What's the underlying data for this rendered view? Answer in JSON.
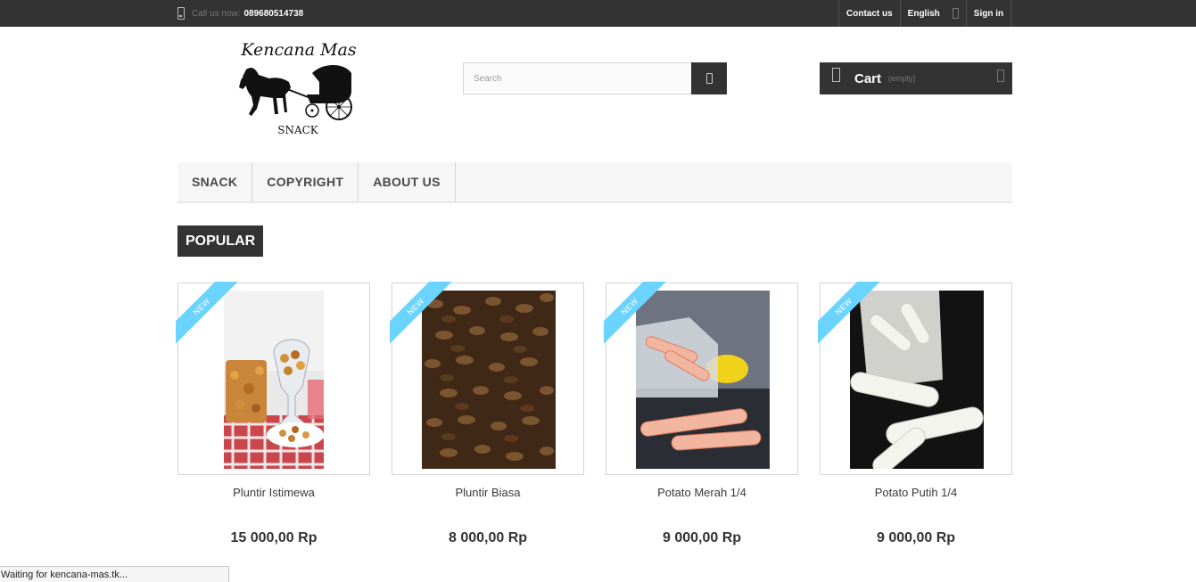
{
  "topbar": {
    "call_prefix": "Call us now:",
    "phone": "089680514738",
    "contact": "Contact us",
    "language": "English",
    "signin": "Sign in"
  },
  "header": {
    "logo_title": "Kencana Mas",
    "logo_sub": "SNACK",
    "search_placeholder": "Search",
    "cart_label": "Cart",
    "cart_status": "(empty)"
  },
  "menu": [
    "SNACK",
    "COPYRIGHT",
    "ABOUT US"
  ],
  "section_tab": "POPULAR",
  "products": [
    {
      "name": "Pluntir Istimewa",
      "price": "15 000,00 Rp",
      "badge": "NEW"
    },
    {
      "name": "Pluntir Biasa",
      "price": "8 000,00 Rp",
      "badge": "NEW"
    },
    {
      "name": "Potato Merah 1/4",
      "price": "9 000,00 Rp",
      "badge": "NEW"
    },
    {
      "name": "Potato Putih 1/4",
      "price": "9 000,00 Rp",
      "badge": "NEW"
    }
  ],
  "status_text": "Waiting for kencana-mas.tk...",
  "colors": {
    "dark": "#333333",
    "ribbon": "#6ad4ff",
    "menu_bg": "#f6f6f6"
  }
}
